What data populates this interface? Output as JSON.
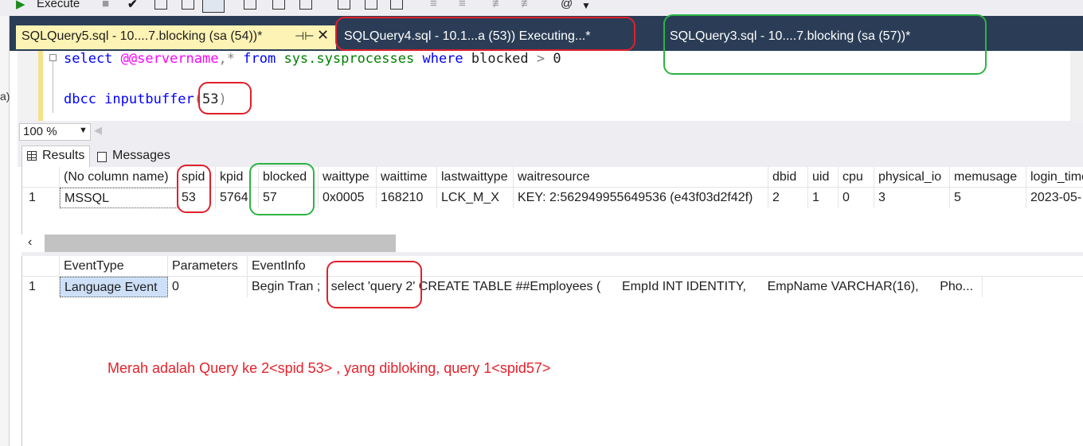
{
  "toolbar": {
    "execute_label": "Execute"
  },
  "tabs": [
    {
      "label": "SQLQuery5.sql - 10....7.blocking (sa (54))*",
      "active": true
    },
    {
      "label": "SQLQuery4.sql - 10.1...a (53)) Executing...*",
      "active": false
    },
    {
      "label": "SQLQuery3.sql - 10....7.blocking (sa (57))*",
      "active": false
    }
  ],
  "tab_icons": {
    "pin": "pin-icon",
    "close": "close-icon"
  },
  "editor": {
    "line1": {
      "kw_select": "select",
      "var": "@@servername",
      "comma": ",",
      "star": "*",
      "kw_from": "from",
      "table": "sys.sysprocesses",
      "kw_where": "where",
      "col": "blocked",
      "op": ">",
      "val": "0"
    },
    "line2": {
      "cmd": "dbcc inputbuffer",
      "open": "(",
      "arg": "53",
      "close": ")"
    }
  },
  "zoom": {
    "value": "100 %"
  },
  "result_tabs": {
    "results": "Results",
    "messages": "Messages"
  },
  "grid1": {
    "columns": [
      "(No column name)",
      "spid",
      "kpid",
      "blocked",
      "waittype",
      "waittime",
      "lastwaittype",
      "waitresource",
      "dbid",
      "uid",
      "cpu",
      "physical_io",
      "memusage",
      "login_time"
    ],
    "rows": [
      {
        "num": "1",
        "cells": [
          "MSSQL",
          "53",
          "5764",
          "57",
          "0x0005",
          "168210",
          "LCK_M_X",
          "KEY: 2:562949955649536 (e43f03d2f42f)",
          "2",
          "1",
          "0",
          "3",
          "5",
          "2023-05-"
        ]
      }
    ]
  },
  "grid2": {
    "columns": [
      "EventType",
      "Parameters",
      "EventInfo"
    ],
    "rows": [
      {
        "num": "1",
        "eventtype": "Language Event",
        "parameters": "0",
        "eventinfo_a": "Begin Tran ;",
        "eventinfo_b": "select 'query 2'",
        "eventinfo_c": "CREATE TABLE ##Employees (      EmpId INT IDENTITY,      EmpName VARCHAR(16),      Pho..."
      }
    ]
  },
  "note": "Merah adalah Query ke 2<spid 53> , yang dibloking, query 1<spid57>",
  "colors": {
    "annotation_red": "#e0202a",
    "annotation_green": "#2cb441",
    "note_red": "#e8202a",
    "tab_active_bg": "#fdf3b4",
    "tab_bar_bg": "#2b3d56"
  }
}
